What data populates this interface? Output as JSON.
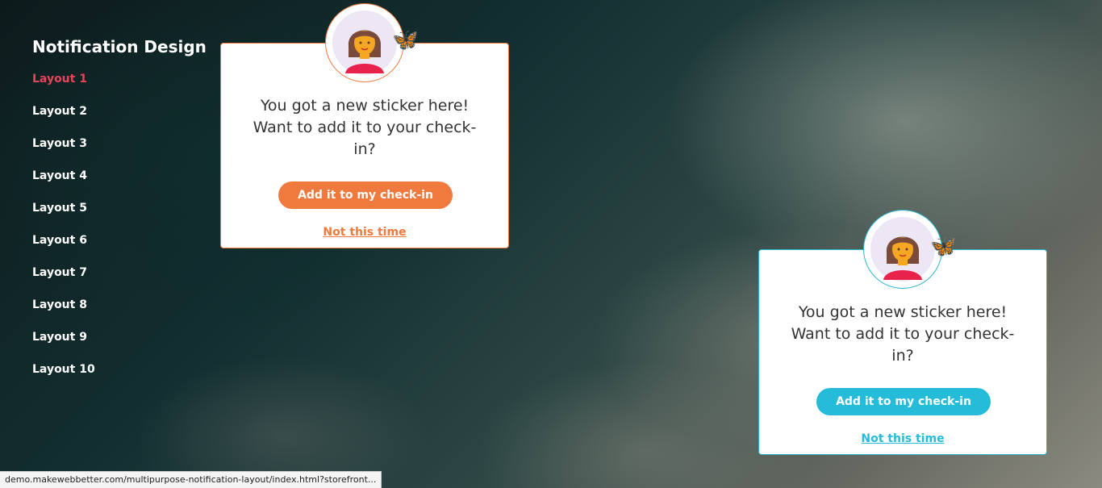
{
  "sidebar": {
    "title": "Notification Design",
    "active_color": "#e8445a",
    "items": [
      {
        "label": "Layout 1"
      },
      {
        "label": "Layout 2"
      },
      {
        "label": "Layout 3"
      },
      {
        "label": "Layout 4"
      },
      {
        "label": "Layout 5"
      },
      {
        "label": "Layout 6"
      },
      {
        "label": "Layout 7"
      },
      {
        "label": "Layout 8"
      },
      {
        "label": "Layout 9"
      },
      {
        "label": "Layout 10"
      }
    ]
  },
  "cards": [
    {
      "theme_color": "#f07a3e",
      "avatar_icon": "woman-avatar-icon",
      "sticker_icon": "butterfly-icon",
      "message": "You got a new sticker here! Want to add it to your check-in?",
      "primary_button": "Add it to my check-in",
      "secondary_link": "Not this time"
    },
    {
      "theme_color": "#24bcd8",
      "avatar_icon": "woman-avatar-icon",
      "sticker_icon": "butterfly-icon",
      "message": "You got a new sticker here! Want to add it to your check-in?",
      "primary_button": "Add it to my check-in",
      "secondary_link": "Not this time"
    }
  ],
  "status_bar": {
    "url": "demo.makewebbetter.com/multipurpose-notification-layout/index.html?storefront..."
  }
}
